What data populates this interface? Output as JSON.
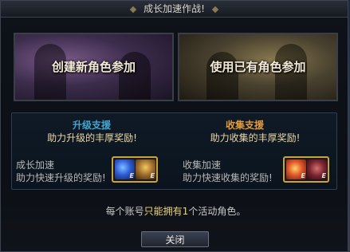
{
  "dialog": {
    "title": "成长加速作战!"
  },
  "choices": {
    "new_character": "创建新角色参加",
    "existing_character": "使用已有角色参加"
  },
  "info": {
    "level_support": {
      "title": "升级支援",
      "subtitle": "助力升级的丰厚奖励!",
      "row_label_line1": "成长加速",
      "row_label_line2": "助力快速升级的奖励!",
      "icons": [
        "dragon-orb-icon",
        "golden-warrior-icon"
      ],
      "badge_text": "E"
    },
    "collect_support": {
      "title": "收集支援",
      "subtitle": "助力收集的丰厚奖励!",
      "row_label_line1": "收集加速",
      "row_label_line2": "助力快速收集的奖励!",
      "icons": [
        "fire-orb-icon",
        "crimson-beast-icon"
      ],
      "badge_text": "E"
    }
  },
  "notice": {
    "prefix": "每个账号",
    "highlight": "只能拥有1",
    "suffix": "个活动角色。"
  },
  "close_button": {
    "label": "关闭"
  },
  "colors": {
    "level_title": "#43a6cf",
    "collect_title": "#e19a3c",
    "reward_text": "#ead7a4",
    "icon_border": "#c9a43a"
  }
}
